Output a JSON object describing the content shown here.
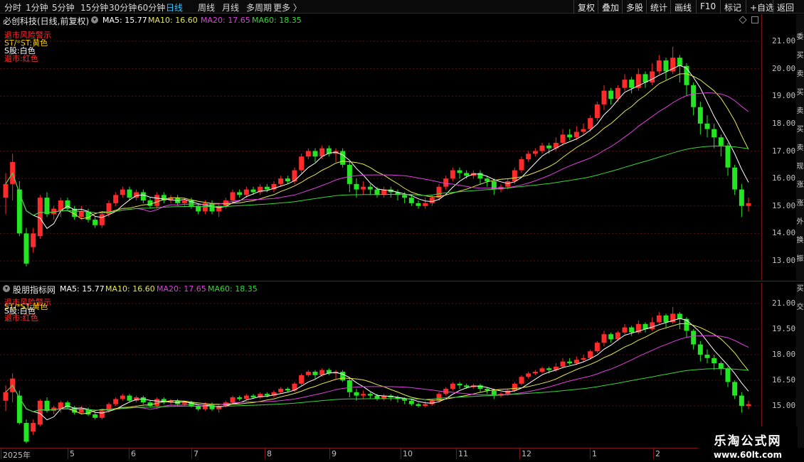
{
  "toolbar": {
    "periods": [
      "分时",
      "1分钟",
      "5分钟",
      "15分钟",
      "30分钟",
      "60分钟",
      "日线",
      "周线",
      "月线",
      "多周期",
      "更多 〉"
    ],
    "active_period": "日线",
    "actions": [
      "复权",
      "叠加",
      "多股",
      "统计",
      "画线",
      "F10",
      "标记",
      "+自选",
      "返回"
    ]
  },
  "upper_panel": {
    "title": "必创科技(日线,前复权)",
    "ma5_label": "MA5: 15.77",
    "ma10_label": "MA10: 16.60",
    "ma20_label": "MA20: 17.65",
    "ma60_label": "MA60: 18.35",
    "legend": [
      "退市风险警示",
      "ST/*ST:黄色",
      "S股:白色",
      "退市:红色"
    ],
    "side_chars": [
      "委",
      "买",
      "卖",
      "买",
      "卖",
      "买",
      "卖",
      "现",
      "涨",
      "涨",
      "外",
      "换",
      "振"
    ]
  },
  "lower_panel": {
    "title": "股朋指标网",
    "ma5_label": "MA5: 15.77",
    "ma10_label": "MA10: 16.60",
    "ma20_label": "MA20: 17.65",
    "ma60_label": "MA60: 18.35",
    "legend": [
      "退市风险警示",
      "ST/*ST:黄色",
      "S股:白色",
      "退市:红色"
    ],
    "side_chars": [
      "买",
      "交"
    ]
  },
  "date_axis": [
    "2025年",
    "5",
    "6",
    "7",
    "8",
    "9",
    "10",
    "11",
    "12",
    "1",
    "2"
  ],
  "watermark": {
    "title": "乐淘公式网",
    "url": "www.60lt.com"
  },
  "colors": {
    "up": "#ff2a2a",
    "down": "#22e622",
    "ma5": "#ffffff",
    "ma10": "#e8e84a",
    "ma20": "#e040e0",
    "ma60": "#36d836",
    "grid": "#5a0f0f",
    "accent": "#35c0ff"
  },
  "chart_data": {
    "type": "candlestick",
    "upper_y_ticks": [
      21.0,
      20.0,
      19.0,
      18.0,
      17.0,
      16.0,
      15.0,
      14.0,
      13.0
    ],
    "lower_y_ticks": [
      21.0,
      19.5,
      18.0,
      16.5,
      15.0
    ],
    "candles": [
      [
        15.3,
        15.8,
        16.2,
        14.7
      ],
      [
        15.8,
        16.6,
        16.9,
        15.2
      ],
      [
        15.6,
        14.0,
        15.9,
        13.9
      ],
      [
        14.0,
        12.9,
        14.2,
        12.8
      ],
      [
        13.5,
        14.0,
        14.2,
        13.3
      ],
      [
        13.9,
        15.3,
        15.4,
        13.8
      ],
      [
        15.3,
        14.7,
        15.5,
        14.6
      ],
      [
        14.7,
        14.9,
        15.0,
        14.5
      ],
      [
        14.8,
        15.2,
        15.3,
        14.6
      ],
      [
        15.2,
        14.9,
        15.3,
        14.8
      ],
      [
        14.9,
        14.6,
        15.0,
        14.5
      ],
      [
        14.6,
        14.8,
        15.0,
        14.5
      ],
      [
        14.8,
        14.5,
        14.9,
        14.4
      ],
      [
        14.5,
        14.3,
        14.6,
        14.2
      ],
      [
        14.3,
        14.7,
        14.8,
        14.2
      ],
      [
        14.7,
        15.1,
        15.2,
        14.6
      ],
      [
        15.1,
        15.4,
        15.5,
        15.0
      ],
      [
        15.4,
        15.6,
        15.7,
        15.3
      ],
      [
        15.6,
        15.3,
        15.7,
        15.2
      ],
      [
        15.3,
        15.5,
        15.6,
        15.2
      ],
      [
        15.5,
        15.2,
        15.6,
        15.1
      ],
      [
        15.2,
        15.0,
        15.3,
        14.9
      ],
      [
        15.0,
        15.4,
        15.5,
        14.9
      ],
      [
        15.4,
        15.2,
        15.5,
        15.1
      ],
      [
        15.2,
        15.3,
        15.4,
        15.1
      ],
      [
        15.3,
        15.1,
        15.4,
        15.0
      ],
      [
        15.1,
        15.2,
        15.3,
        15.0
      ],
      [
        15.2,
        15.0,
        15.3,
        14.9
      ],
      [
        15.0,
        14.8,
        15.1,
        14.7
      ],
      [
        14.8,
        15.1,
        15.2,
        14.7
      ],
      [
        15.1,
        14.8,
        15.2,
        14.7
      ],
      [
        14.8,
        15.0,
        15.1,
        14.6
      ],
      [
        15.0,
        15.2,
        15.3,
        14.9
      ],
      [
        15.2,
        15.5,
        15.6,
        15.1
      ],
      [
        15.5,
        15.4,
        15.6,
        15.3
      ],
      [
        15.4,
        15.6,
        15.7,
        15.3
      ],
      [
        15.6,
        15.5,
        15.7,
        15.4
      ],
      [
        15.5,
        15.7,
        15.8,
        15.4
      ],
      [
        15.7,
        15.6,
        15.8,
        15.5
      ],
      [
        15.6,
        15.8,
        15.9,
        15.5
      ],
      [
        15.8,
        16.0,
        16.1,
        15.7
      ],
      [
        16.0,
        15.9,
        16.1,
        15.8
      ],
      [
        15.9,
        16.3,
        16.4,
        15.8
      ],
      [
        16.3,
        16.8,
        16.9,
        16.2
      ],
      [
        16.8,
        17.0,
        17.1,
        16.7
      ],
      [
        17.0,
        16.8,
        17.1,
        16.6
      ],
      [
        16.8,
        17.1,
        17.2,
        16.7
      ],
      [
        17.1,
        16.9,
        17.2,
        16.8
      ],
      [
        16.9,
        17.0,
        17.1,
        16.6
      ],
      [
        17.0,
        16.5,
        17.1,
        16.4
      ],
      [
        16.5,
        15.8,
        16.6,
        15.5
      ],
      [
        15.8,
        15.6,
        16.0,
        15.3
      ],
      [
        15.6,
        15.7,
        15.9,
        15.4
      ],
      [
        15.7,
        15.6,
        15.8,
        15.4
      ],
      [
        15.6,
        15.4,
        15.7,
        15.3
      ],
      [
        15.4,
        15.6,
        15.7,
        15.3
      ],
      [
        15.6,
        15.5,
        15.7,
        15.3
      ],
      [
        15.5,
        15.4,
        15.6,
        15.2
      ],
      [
        15.4,
        15.3,
        15.5,
        15.1
      ],
      [
        15.3,
        15.1,
        15.4,
        15.0
      ],
      [
        15.1,
        15.0,
        15.2,
        14.9
      ],
      [
        15.0,
        15.1,
        15.3,
        14.9
      ],
      [
        15.1,
        15.3,
        15.4,
        15.0
      ],
      [
        15.3,
        15.7,
        15.8,
        15.2
      ],
      [
        15.7,
        16.0,
        16.1,
        15.6
      ],
      [
        16.0,
        16.3,
        16.4,
        15.9
      ],
      [
        16.3,
        16.2,
        16.4,
        16.0
      ],
      [
        16.2,
        16.1,
        16.3,
        16.0
      ],
      [
        16.1,
        16.2,
        16.3,
        16.0
      ],
      [
        16.2,
        16.0,
        16.3,
        15.8
      ],
      [
        16.0,
        15.9,
        16.1,
        15.7
      ],
      [
        15.9,
        15.6,
        16.0,
        15.4
      ],
      [
        15.6,
        15.7,
        15.8,
        15.5
      ],
      [
        15.7,
        15.9,
        16.0,
        15.6
      ],
      [
        15.9,
        16.3,
        16.4,
        15.8
      ],
      [
        16.3,
        16.7,
        16.8,
        16.2
      ],
      [
        16.7,
        16.9,
        17.0,
        16.6
      ],
      [
        16.9,
        17.0,
        17.1,
        16.8
      ],
      [
        17.0,
        17.2,
        17.3,
        16.9
      ],
      [
        17.2,
        17.1,
        17.3,
        16.9
      ],
      [
        17.1,
        17.3,
        17.5,
        17.0
      ],
      [
        17.3,
        17.6,
        17.8,
        17.2
      ],
      [
        17.6,
        17.5,
        17.8,
        17.4
      ],
      [
        17.5,
        17.7,
        17.9,
        17.4
      ],
      [
        17.7,
        17.8,
        18.0,
        17.6
      ],
      [
        17.8,
        18.2,
        18.3,
        17.7
      ],
      [
        18.2,
        18.7,
        18.8,
        18.1
      ],
      [
        18.7,
        19.2,
        19.4,
        18.5
      ],
      [
        19.2,
        18.9,
        19.3,
        18.7
      ],
      [
        18.9,
        19.3,
        19.4,
        18.8
      ],
      [
        19.3,
        19.6,
        19.8,
        19.2
      ],
      [
        19.6,
        19.3,
        19.7,
        19.1
      ],
      [
        19.3,
        19.8,
        20.0,
        19.2
      ],
      [
        19.8,
        19.5,
        19.9,
        19.3
      ],
      [
        19.5,
        19.9,
        20.2,
        19.4
      ],
      [
        19.9,
        20.3,
        20.5,
        19.8
      ],
      [
        20.3,
        19.9,
        20.4,
        19.6
      ],
      [
        19.9,
        20.4,
        20.8,
        19.8
      ],
      [
        20.4,
        20.1,
        20.5,
        19.5
      ],
      [
        20.1,
        19.4,
        20.2,
        19.0
      ],
      [
        19.4,
        18.6,
        19.5,
        18.3
      ],
      [
        18.6,
        18.0,
        18.8,
        17.6
      ],
      [
        18.0,
        17.8,
        18.3,
        17.5
      ],
      [
        17.8,
        17.5,
        18.0,
        17.1
      ],
      [
        17.5,
        17.2,
        17.6,
        16.8
      ],
      [
        17.2,
        16.4,
        17.3,
        16.1
      ],
      [
        16.4,
        15.6,
        16.5,
        15.4
      ],
      [
        15.6,
        15.0,
        15.8,
        14.6
      ],
      [
        15.0,
        15.1,
        15.3,
        14.8
      ]
    ]
  }
}
